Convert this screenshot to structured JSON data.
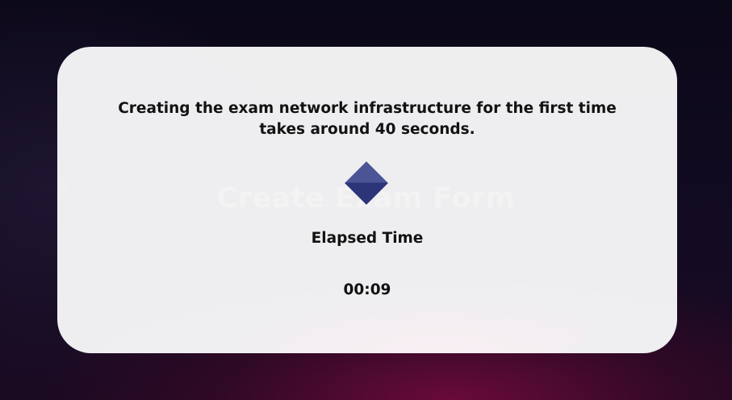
{
  "background": {
    "page_title": "Create Exam Form"
  },
  "modal": {
    "message": "Creating the exam network infrastructure for the first time takes around 40 seconds.",
    "spinner_icon": "diamond-spinner-icon",
    "elapsed_label": "Elapsed Time",
    "elapsed_value": "00:09"
  },
  "colors": {
    "spinner": "#2b3578",
    "modal_bg": "#f6f6f7",
    "text": "#121212",
    "background_dark": "#0b0818",
    "background_accent": "#780a3c"
  }
}
